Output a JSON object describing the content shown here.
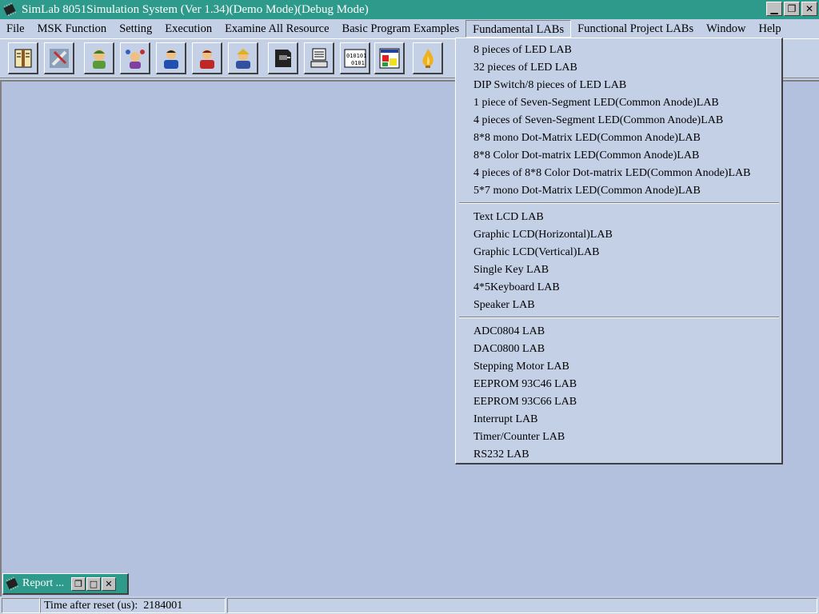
{
  "window": {
    "title": "SimLab 8051Simulation System (Ver  1.34)(Demo Mode)(Debug Mode)",
    "title_bar_color": "#2d9a8c",
    "icons": [
      "minimize-icon",
      "restore-icon",
      "close-icon"
    ]
  },
  "menubar": {
    "items": [
      {
        "label": "File"
      },
      {
        "label": "MSK Function"
      },
      {
        "label": "Setting"
      },
      {
        "label": "Execution"
      },
      {
        "label": "Examine All Resource"
      },
      {
        "label": "Basic Program Examples"
      },
      {
        "label": "Fundamental  LABs"
      },
      {
        "label": "Functional Project LABs"
      },
      {
        "label": "Window"
      },
      {
        "label": "Help"
      }
    ],
    "open_menu": "Fundamental  LABs"
  },
  "toolbar": {
    "buttons": [
      {
        "name": "book-icon"
      },
      {
        "name": "tools-icon"
      },
      {
        "name": "person-green-icon"
      },
      {
        "name": "person-juggler-icon"
      },
      {
        "name": "person-blue-icon"
      },
      {
        "name": "person-red-icon"
      },
      {
        "name": "person-yellow-icon"
      },
      {
        "name": "chip-plug-icon"
      },
      {
        "name": "computer-icon"
      },
      {
        "name": "binary-data-icon"
      },
      {
        "name": "color-chart-icon"
      },
      {
        "name": "flame-icon"
      }
    ]
  },
  "dropdown": {
    "group1": [
      "8 pieces of   LED LAB",
      "32 pieces of   LED LAB",
      "DIP Switch/8 pieces of   LED LAB",
      "1 piece of   Seven-Segment LED(Common Anode)LAB",
      "4 pieces of   Seven-Segment LED(Common Anode)LAB",
      "8*8 mono Dot-Matrix LED(Common Anode)LAB",
      "8*8 Color Dot-matrix LED(Common Anode)LAB",
      "4 pieces of   8*8 Color Dot-matrix LED(Common Anode)LAB",
      "5*7 mono Dot-Matrix  LED(Common Anode)LAB"
    ],
    "group2": [
      "Text LCD LAB",
      "Graphic LCD(Horizontal)LAB",
      "Graphic LCD(Vertical)LAB",
      "Single Key LAB",
      "4*5Keyboard LAB",
      "Speaker LAB"
    ],
    "group3": [
      "ADC0804 LAB",
      "DAC0800 LAB",
      "Stepping Motor LAB",
      "EEPROM 93C46 LAB",
      "EEPROM 93C66 LAB",
      "Interrupt LAB",
      "Timer/Counter LAB",
      "RS232 LAB"
    ]
  },
  "report_window": {
    "title": "Report ..."
  },
  "statusbar": {
    "label": "Time after reset (us):",
    "value": "2184001"
  }
}
